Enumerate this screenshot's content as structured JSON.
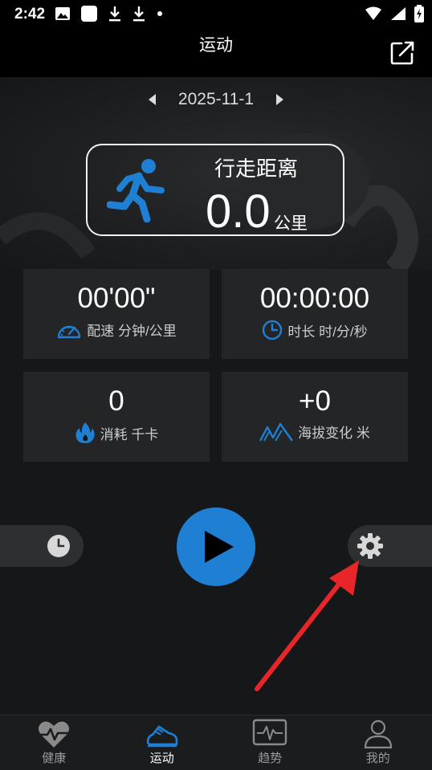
{
  "status_bar": {
    "time": "2:42"
  },
  "app_bar": {
    "title": "运动"
  },
  "date_nav": {
    "date": "2025-11-1"
  },
  "distance": {
    "label": "行走距离",
    "value": "0.0",
    "unit": "公里"
  },
  "stats": [
    {
      "value": "00'00\"",
      "label": "配速 分钟/公里",
      "icon": "speedometer-icon"
    },
    {
      "value": "00:00:00",
      "label": "时长 时/分/秒",
      "icon": "clock-icon"
    },
    {
      "value": "0",
      "label": "消耗 千卡",
      "icon": "flame-icon"
    },
    {
      "value": "+0",
      "label": "海拔变化 米",
      "icon": "mountain-icon"
    }
  ],
  "bottom_nav": [
    {
      "label": "健康",
      "icon": "heart-pulse-icon",
      "active": false
    },
    {
      "label": "运动",
      "icon": "shoe-icon",
      "active": true
    },
    {
      "label": "趋势",
      "icon": "trend-monitor-icon",
      "active": false
    },
    {
      "label": "我的",
      "icon": "person-icon",
      "active": false
    }
  ],
  "colors": {
    "accent": "#1f7fd3",
    "annotation_arrow": "#e8262a"
  }
}
